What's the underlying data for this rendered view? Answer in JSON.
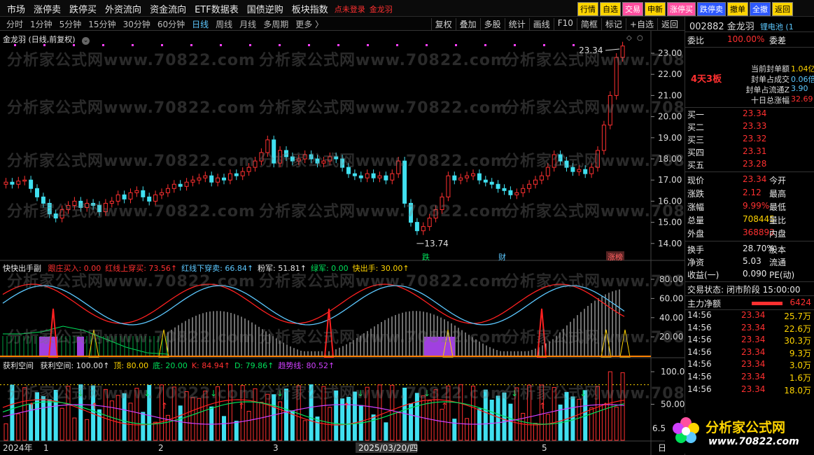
{
  "topmenu": {
    "items": [
      "市场",
      "涨停卖",
      "跌停买",
      "外资流向",
      "资金流向",
      "ETF数据表",
      "国债逆购",
      "板块指数"
    ],
    "login": "点未登录",
    "stock_name_red": "金龙羽",
    "quick": [
      "行情",
      "自选",
      "交易",
      "申新",
      "涨停买",
      "跌停卖",
      "撤单",
      "全撤",
      "返回"
    ]
  },
  "periodbar": {
    "periods": [
      "分时",
      "1分钟",
      "5分钟",
      "15分钟",
      "30分钟",
      "60分钟",
      "日线",
      "周线",
      "月线",
      "多周期",
      "更多 〉"
    ],
    "active": "日线",
    "tools": [
      "复权",
      "叠加",
      "多股",
      "统计",
      "画线",
      "F10",
      "简框",
      "标记",
      "+自选",
      "返回"
    ]
  },
  "main_chart": {
    "label": "金龙羽 (日线,前复权)",
    "high_label": "23.34",
    "low_label": "13.74",
    "price_axis": [
      "23.00",
      "22.00",
      "21.00",
      "20.00",
      "19.00",
      "18.00",
      "17.00",
      "16.00",
      "15.00",
      "14.00"
    ],
    "markers": {
      "m1": "跌",
      "m2": "财",
      "m3": "涨榜"
    }
  },
  "indicator1": {
    "name": "快快出手副",
    "items": [
      {
        "text": "跟庄买入: 0.00",
        "color": "#ff3030"
      },
      {
        "text": "红线上穿买: 73.56↑",
        "color": "#ff3030"
      },
      {
        "text": "红线下穿卖: 66.84↑",
        "color": "#5cc8ff"
      },
      {
        "text": "粉军: 51.81↑",
        "color": "#e8e8e8"
      },
      {
        "text": "绿军: 0.00",
        "color": "#00e05a"
      },
      {
        "text": "快出手: 30.00↑",
        "color": "#ffd400"
      }
    ],
    "axis": [
      "80.00",
      "60.00",
      "40.00",
      "20.00"
    ]
  },
  "indicator2": {
    "name": "获利空间",
    "items": [
      {
        "text": "获利空间: 100.00↑",
        "color": "#e8e8e8"
      },
      {
        "text": "顶: 80.00",
        "color": "#ffd400"
      },
      {
        "text": "底: 20.00",
        "color": "#00e05a"
      },
      {
        "text": "K: 84.94↑",
        "color": "#ff3030"
      },
      {
        "text": "D: 79.86↑",
        "color": "#00e05a"
      },
      {
        "text": "趋势线: 80.52↑",
        "color": "#d040ff"
      }
    ],
    "axis": [
      "100.0",
      "50.00"
    ],
    "extra": "6.50"
  },
  "xaxis": {
    "year": "2024年",
    "m1": "1",
    "m2": "2",
    "m3": "3",
    "date": "2025/03/20/四",
    "m5": "5",
    "right": "日"
  },
  "panel": {
    "code": "002882",
    "name": "金龙羽",
    "tag": "锂电池 (1",
    "webi_label": "委比",
    "webi_value": "100.00%",
    "webi_right": "委差",
    "board": "4天3板",
    "stats": [
      {
        "label": "当前封单额",
        "value": "1.04亿"
      },
      {
        "label": "封单占成交",
        "value": "0.06倍"
      },
      {
        "label": "封单占流通Z",
        "value": "3.90"
      },
      {
        "label": "十日总涨幅",
        "value": "32.69"
      }
    ],
    "asks": [
      {
        "label": "买一",
        "price": "23.34"
      },
      {
        "label": "买二",
        "price": "23.33"
      },
      {
        "label": "买三",
        "price": "23.32"
      },
      {
        "label": "买四",
        "price": "23.31"
      },
      {
        "label": "买五",
        "price": "23.28"
      }
    ],
    "quote": [
      {
        "label": "现价",
        "value": "23.34",
        "right": "今开",
        "color": "red"
      },
      {
        "label": "涨跌",
        "value": "2.12",
        "right": "最高",
        "color": "red"
      },
      {
        "label": "涨幅",
        "value": "9.99%",
        "right": "最低",
        "color": "red"
      },
      {
        "label": "总量",
        "value": "708445",
        "right": "量比",
        "color": "yellow"
      },
      {
        "label": "外盘",
        "value": "368892",
        "right": "内盘",
        "color": "red"
      }
    ],
    "fin": [
      {
        "label": "换手",
        "value": "28.70%",
        "right": "股本"
      },
      {
        "label": "净资",
        "value": "5.03",
        "right": "流通"
      },
      {
        "label": "收益(一)",
        "value": "0.090",
        "right": "PE(动)"
      }
    ],
    "status": "交易状态: 闭市阶段  15:00:00",
    "main_flow_label": "主力净额",
    "main_flow_value": "6424",
    "trades": [
      {
        "t": "14:56",
        "p": "23.34",
        "q": "25.7万"
      },
      {
        "t": "14:56",
        "p": "23.34",
        "q": "22.6万"
      },
      {
        "t": "14:56",
        "p": "23.34",
        "q": "30.3万"
      },
      {
        "t": "14:56",
        "p": "23.34",
        "q": "9.3万"
      },
      {
        "t": "14:56",
        "p": "23.34",
        "q": "3.0万"
      },
      {
        "t": "14:56",
        "p": "23.34",
        "q": "1.6万"
      },
      {
        "t": "14:56",
        "p": "23.34",
        "q": "18.0万"
      }
    ]
  },
  "watermark": "分析家公式网www.70822.com",
  "logo": {
    "title": "分析家公式网",
    "url": "www.70822.com"
  },
  "colors": {
    "up": "#ff3030",
    "down": "#40e0f0",
    "bg": "#000000"
  }
}
